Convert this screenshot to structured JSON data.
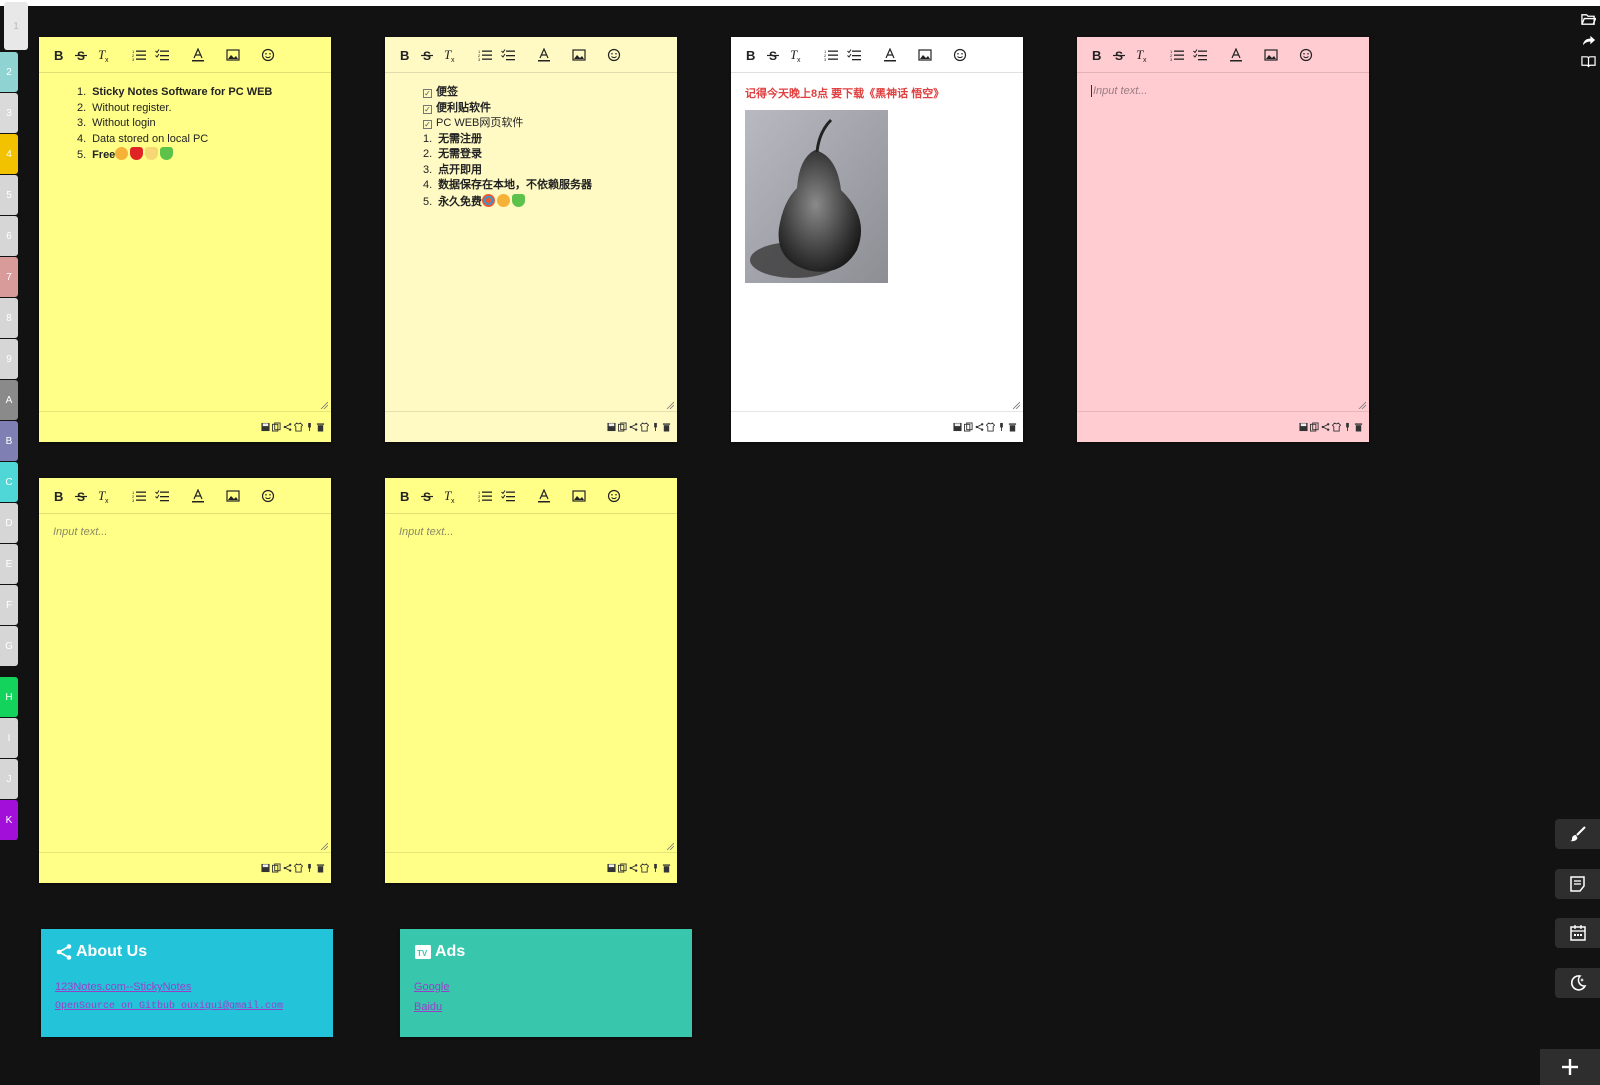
{
  "tabs": [
    {
      "label": "1",
      "color": "#e8e8e8"
    },
    {
      "label": "2",
      "color": "#8fd3d3"
    },
    {
      "label": "3",
      "color": "#dadada"
    },
    {
      "label": "4",
      "color": "#f2c200"
    },
    {
      "label": "5",
      "color": "#d6d6d6"
    },
    {
      "label": "6",
      "color": "#d6d6d6"
    },
    {
      "label": "7",
      "color": "#d99a9a"
    },
    {
      "label": "8",
      "color": "#d6d6d6"
    },
    {
      "label": "9",
      "color": "#d6d6d6"
    },
    {
      "label": "A",
      "color": "#8a8a8a"
    },
    {
      "label": "B",
      "color": "#7f7fb3"
    },
    {
      "label": "C",
      "color": "#4fd6d6"
    },
    {
      "label": "D",
      "color": "#d6d6d6"
    },
    {
      "label": "E",
      "color": "#d6d6d6"
    },
    {
      "label": "F",
      "color": "#d6d6d6"
    },
    {
      "label": "G",
      "color": "#d6d6d6"
    },
    {
      "label": "H",
      "color": "#14d35c"
    },
    {
      "label": "I",
      "color": "#d6d6d6"
    },
    {
      "label": "J",
      "color": "#d6d6d6"
    },
    {
      "label": "K",
      "color": "#a10fd8"
    }
  ],
  "toolbar_icons": [
    "bold-icon",
    "strikethrough-icon",
    "clear-format-icon",
    "ordered-list-icon",
    "checklist-icon",
    "font-color-icon",
    "image-icon",
    "emoji-icon"
  ],
  "footer_icons": [
    "save-icon",
    "copy-icon",
    "share-icon",
    "color-icon",
    "pin-icon",
    "delete-icon"
  ],
  "notes": [
    {
      "color": "#ffff88",
      "items": [
        {
          "num": "1.",
          "text": "Sticky Notes Software for PC WEB",
          "bold": true
        },
        {
          "num": "2.",
          "text": "Without register."
        },
        {
          "num": "3.",
          "text": "Without login"
        },
        {
          "num": "4.",
          "text": "Data stored on local PC"
        },
        {
          "num": "5.",
          "text": "Free",
          "bold": true
        }
      ]
    },
    {
      "color": "#fffac4",
      "checks": [
        "便签",
        "便利贴软件",
        "PC WEB网页软件"
      ],
      "items": [
        {
          "num": "1.",
          "text": "无需注册"
        },
        {
          "num": "2.",
          "text": "无需登录"
        },
        {
          "num": "3.",
          "text": "点开即用"
        },
        {
          "num": "4.",
          "text": "数据保存在本地，不依赖服务器"
        },
        {
          "num": "5.",
          "text": "永久免费"
        }
      ]
    },
    {
      "color": "#ffffff",
      "text": "记得今天晚上8点 要下载《黑神话 悟空》",
      "image_alt": "pear-sketch"
    },
    {
      "color": "#ffccd2",
      "placeholder": "Input text..."
    },
    {
      "color": "#ffff88",
      "placeholder": "Input text..."
    },
    {
      "color": "#ffff88",
      "placeholder": "Input text..."
    }
  ],
  "about": {
    "title": "About Us",
    "color": "#23c4da",
    "links": [
      "123Notes.com--StickyNotes",
      "OpenSource on Gitbub ouxigui@gmail.com"
    ]
  },
  "ads": {
    "title": "Ads",
    "color": "#38c7ad",
    "links": [
      "Google",
      "Baidu"
    ]
  }
}
